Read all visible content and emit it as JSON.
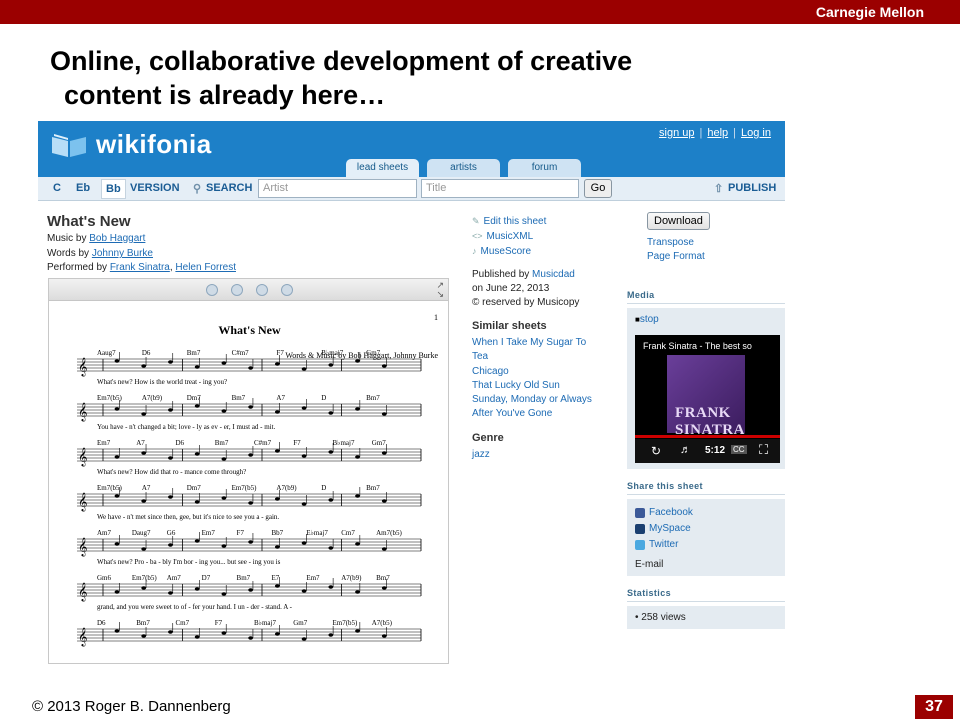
{
  "slide": {
    "header_org": "Carnegie Mellon",
    "title_line1": "Online, collaborative development of creative",
    "title_line2": "content is already here…",
    "footer": "© 2013 Roger B. Dannenberg",
    "page_number": "37",
    "accent_color": "#9b0000"
  },
  "site": {
    "logo": "wikifonia",
    "top_links": [
      "sign up",
      "help",
      "Log in"
    ],
    "tabs": [
      "lead sheets",
      "artists",
      "forum"
    ],
    "nav": {
      "keys": [
        "C",
        "Eb",
        "Bb"
      ],
      "selected_key": "Bb",
      "version": "VERSION",
      "search": "SEARCH",
      "artist_placeholder": "Artist",
      "title_placeholder": "Title",
      "go": "Go",
      "publish": "PUBLISH"
    },
    "brand_color": "#1d80c8"
  },
  "song": {
    "title": "What's New",
    "music_by_label": "Music by",
    "music_by": "Bob Haggart",
    "words_by_label": "Words by",
    "words_by": "Johnny Burke",
    "performed_by_label": "Performed by",
    "performer1": "Frank Sinatra",
    "performer2": "Helen Forrest"
  },
  "sheet": {
    "title": "What's New",
    "page": "1",
    "credit": "Words & Music by Bob Haggart, Johnny Burke",
    "chords": [
      [
        "Aaug7",
        "D6",
        "Bm7",
        "C#m7",
        "F7",
        "B♭maj7",
        "Gm7"
      ],
      [
        "Em7(b5)",
        "A7(b9)",
        "Dm7",
        "Bm7",
        "A7",
        "D",
        "Bm7"
      ],
      [
        "Em7",
        "A7",
        "D6",
        "Bm7",
        "C#m7",
        "F7",
        "B♭maj7",
        "Gm7"
      ],
      [
        "Em7(b5)",
        "A7",
        "Dm7",
        "Em7(b5)",
        "A7(b9)",
        "D",
        "Bm7"
      ],
      [
        "Am7",
        "Daug7",
        "G6",
        "Em7",
        "F7",
        "Bb7",
        "E♭maj7",
        "Cm7",
        "Am7(b5)"
      ],
      [
        "Gm6",
        "Em7(b5)",
        "Am7",
        "D7",
        "Bm7",
        "E7",
        "Em7",
        "A7(b9)",
        "Bm7"
      ],
      [
        "D6",
        "Bm7",
        "Cm7",
        "F7",
        "B♭maj7",
        "Gm7",
        "Em7(b5)",
        "A7(b5)"
      ]
    ],
    "lyrics": [
      "What's new? How is the world treat - ing you?",
      "You have - n't changed a bit; love - ly as ev - er, I must ad - mit.",
      "What's new? How did that ro - mance come through?",
      "We have - n't met since then, gee, but it's nice to see you a - gain.",
      "What's new? Pro - ba - bly I'm bor - ing you... but see - ing you is",
      "grand, and you were sweet to of - fer your hand. I un - der - stand. A -"
    ]
  },
  "sidebar_mid": {
    "edit": "Edit this sheet",
    "musicxml": "MusicXML",
    "musescore": "MuseScore",
    "published_by_label": "Published by",
    "published_by": "Musicdad",
    "published_on": "on June 22, 2013",
    "reserved": "© reserved by Musicopy",
    "similar_title": "Similar sheets",
    "similar": [
      "When I Take My Sugar To Tea",
      "Chicago",
      "That Lucky Old Sun",
      "Sunday, Monday or Always",
      "After You've Gone"
    ],
    "genre_title": "Genre",
    "genre": "jazz"
  },
  "sidebar_right": {
    "download": "Download",
    "transpose": "Transpose",
    "page_format": "Page Format",
    "media_title": "Media",
    "stop": "stop",
    "video_title": "Frank Sinatra - The best so",
    "video_art": "FRANK SINATRA",
    "video_time": "5:12",
    "share_title": "Share this sheet",
    "share": [
      "Facebook",
      "MySpace",
      "Twitter"
    ],
    "email": "E-mail",
    "stats_title": "Statistics",
    "views": "258 views"
  }
}
